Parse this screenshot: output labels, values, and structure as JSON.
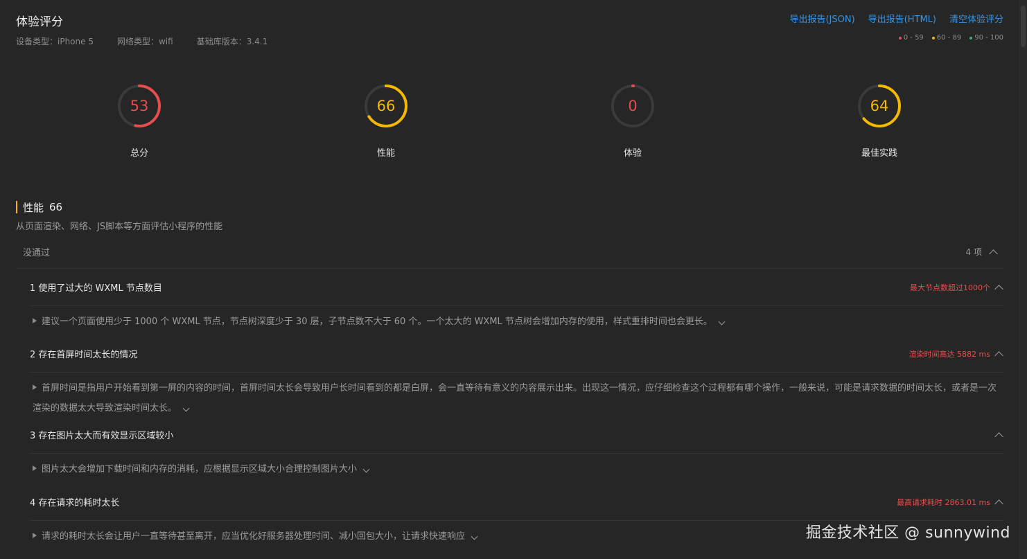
{
  "header": {
    "title": "体验评分",
    "device_type": "设备类型：iPhone 5",
    "network_type": "网络类型：wifi",
    "lib_version": "基础库版本：3.4.1"
  },
  "actions": {
    "export_json": "导出报告(JSON)",
    "export_html": "导出报告(HTML)",
    "clear": "清空体验评分"
  },
  "legend": [
    {
      "range": "0 - 59",
      "color": "#e84d4d"
    },
    {
      "range": "60 - 89",
      "color": "#f5b800"
    },
    {
      "range": "90 - 100",
      "color": "#2ebd6b"
    }
  ],
  "gauges": [
    {
      "label": "总分",
      "score": "53",
      "value": 53,
      "color": "#e84d4d"
    },
    {
      "label": "性能",
      "score": "66",
      "value": 66,
      "color": "#f5b800"
    },
    {
      "label": "体验",
      "score": "0",
      "value": 0,
      "color": "#e84d4d"
    },
    {
      "label": "最佳实践",
      "score": "64",
      "value": 64,
      "color": "#f5b800"
    }
  ],
  "section": {
    "title": "性能",
    "score": "66",
    "description": "从页面渲染、网络、JS脚本等方面评估小程序的性能"
  },
  "group": {
    "name": "没通过",
    "count": "4 项"
  },
  "items": [
    {
      "title": "1 使用了过大的 WXML 节点数目",
      "badge": "最大节点数超过1000个",
      "desc": "建议一个页面使用少于 1000 个 WXML 节点，节点树深度少于 30 层，子节点数不大于 60 个。一个太大的 WXML 节点树会增加内存的使用，样式重排时间也会更长。"
    },
    {
      "title": "2 存在首屏时间太长的情况",
      "badge": "渲染时间高达 5882 ms",
      "desc": "首屏时间是指用户开始看到第一屏的内容的时间，首屏时间太长会导致用户长时间看到的都是白屏，会一直等待有意义的内容展示出来。出现这一情况，应仔细检查这个过程都有哪个操作，一般来说，可能是请求数据的时间太长，或者是一次渲染的数据太大导致渲染时间太长。"
    },
    {
      "title": "3 存在图片太大而有效显示区域较小",
      "badge": "",
      "desc": "图片太大会增加下载时间和内存的消耗，应根据显示区域大小合理控制图片大小"
    },
    {
      "title": "4 存在请求的耗时太长",
      "badge": "最高请求耗时 2863.01 ms",
      "desc": "请求的耗时太长会让用户一直等待甚至离开，应当优化好服务器处理时间、减小回包大小，让请求快速响应"
    }
  ],
  "watermark": "掘金技术社区 @ sunnywind"
}
